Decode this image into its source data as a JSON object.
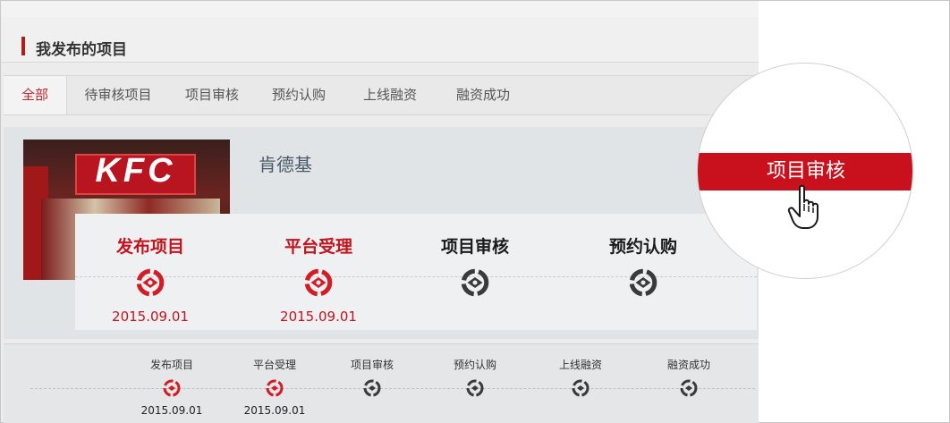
{
  "header": {
    "title": "我发布的项目"
  },
  "tabs": [
    {
      "label": "全部",
      "active": true
    },
    {
      "label": "待审核项目"
    },
    {
      "label": "项目审核"
    },
    {
      "label": "预约认购"
    },
    {
      "label": "上线融资"
    },
    {
      "label": "融资成功"
    }
  ],
  "project": {
    "name": "肯德基",
    "image_logo_text": "KFC"
  },
  "progress_large": [
    {
      "label": "发布项目",
      "date": "2015.09.01",
      "status": "done"
    },
    {
      "label": "平台受理",
      "date": "2015.09.01",
      "status": "done"
    },
    {
      "label": "项目审核",
      "date": "",
      "status": "pending"
    },
    {
      "label": "预约认购",
      "date": "",
      "status": "pending"
    }
  ],
  "progress_small": [
    {
      "label": "发布项目",
      "date": "2015.09.01",
      "status": "done"
    },
    {
      "label": "平台受理",
      "date": "2015.09.01",
      "status": "done"
    },
    {
      "label": "项目审核",
      "date": "",
      "status": "pending"
    },
    {
      "label": "预约认购",
      "date": "",
      "status": "pending"
    },
    {
      "label": "上线融资",
      "date": "",
      "status": "pending"
    },
    {
      "label": "融资成功",
      "date": "",
      "status": "pending"
    }
  ],
  "callout": {
    "label": "项目审核",
    "icon": "hand-pointer-icon"
  },
  "colors": {
    "accent": "#c2141f",
    "done_icon": "#d21c26",
    "pending_icon": "#3a3a3a",
    "panel": "#ececec"
  }
}
